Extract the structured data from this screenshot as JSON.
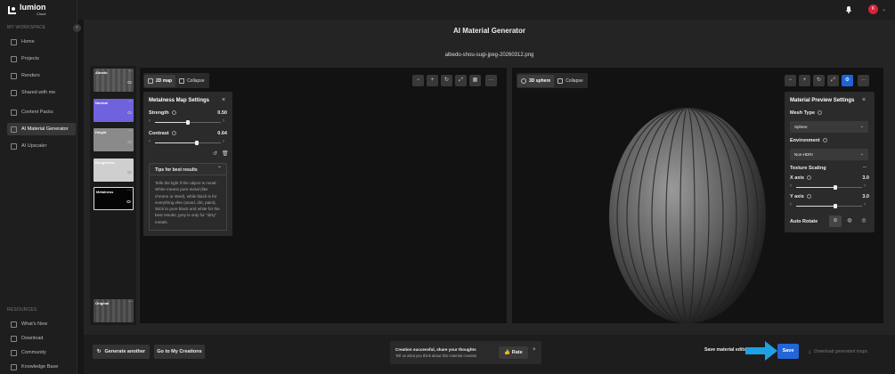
{
  "brand": {
    "name": "lumion",
    "sub": "Cloud"
  },
  "sidebar": {
    "workspace_label": "MY WORKSPACE",
    "resources_label": "RESOURCES",
    "items": [
      {
        "label": "Home",
        "icon": "home-icon"
      },
      {
        "label": "Projects",
        "icon": "projects-icon"
      },
      {
        "label": "Renders",
        "icon": "renders-icon"
      },
      {
        "label": "Shared with me",
        "icon": "shared-icon"
      },
      {
        "label": "Content Packs",
        "icon": "content-packs-icon"
      },
      {
        "label": "AI Material Generator",
        "icon": "ai-material-icon",
        "active": true
      },
      {
        "label": "AI Upscaler",
        "icon": "ai-upscaler-icon"
      }
    ],
    "resources": [
      {
        "label": "What's New",
        "icon": "whats-new-icon"
      },
      {
        "label": "Download",
        "icon": "download-icon"
      },
      {
        "label": "Community",
        "icon": "community-icon"
      },
      {
        "label": "Knowledge Base",
        "icon": "knowledge-base-icon"
      }
    ]
  },
  "header": {
    "avatar_initial": "K"
  },
  "page": {
    "title": "AI Material Generator",
    "filename": "albedo-shou-sugi-jpeg-20260312.png"
  },
  "maps": [
    {
      "label": "Albedo",
      "color": "#5a5a5a"
    },
    {
      "label": "Normal",
      "color": "#7a6ee6"
    },
    {
      "label": "Height",
      "color": "#8a8a8a"
    },
    {
      "label": "Roughness",
      "color": "#cfcfcf"
    },
    {
      "label": "Metalness",
      "color": "#050505",
      "selected": true
    },
    {
      "label": "Original",
      "color": "#4a4a4a"
    }
  ],
  "view2d": {
    "map_label": "2D map",
    "collapse_label": "Collapse"
  },
  "view3d": {
    "sphere_label": "3D sphere",
    "collapse_label": "Collapse"
  },
  "metalness_settings": {
    "title": "Metalness Map Settings",
    "strength_label": "Strength",
    "strength_value": "0.50",
    "strength_fraction": 0.5,
    "contrast_label": "Contrast",
    "contrast_value": "0.64",
    "contrast_fraction": 0.64,
    "tips_title": "Tips for best results",
    "tips_body": "Tells the light if the object is metal. White means pure metal (like chrome or steel), while black is for everything else (wood, dirt, paint). Stick to pure black and white for the best results; grey is only for \"dirty\" metals."
  },
  "preview_settings": {
    "title": "Material Preview Settings",
    "mesh_type_label": "Mesh Type",
    "mesh_type_value": "Sphere",
    "environment_label": "Environment",
    "environment_value": "Non-HDRI",
    "texture_scaling_label": "Texture Scaling",
    "x_axis_label": "X axis",
    "x_axis_value": "3.0",
    "x_axis_fraction": 0.6,
    "y_axis_label": "Y axis",
    "y_axis_value": "3.0",
    "y_axis_fraction": 0.6,
    "auto_rotate_label": "Auto Rotate"
  },
  "bottom": {
    "generate_another": "Generate another",
    "go_to_creations": "Go to My Creations",
    "toast_title": "Creation successful, share your thoughts",
    "toast_sub": "Tell us what you think about this material creation",
    "rate_label": "Rate",
    "save_edits_label": "Save material edits",
    "save_label": "Save",
    "download_label": "Download generated maps"
  },
  "colors": {
    "accent": "#2266d8",
    "arrow": "#1da1e2"
  }
}
